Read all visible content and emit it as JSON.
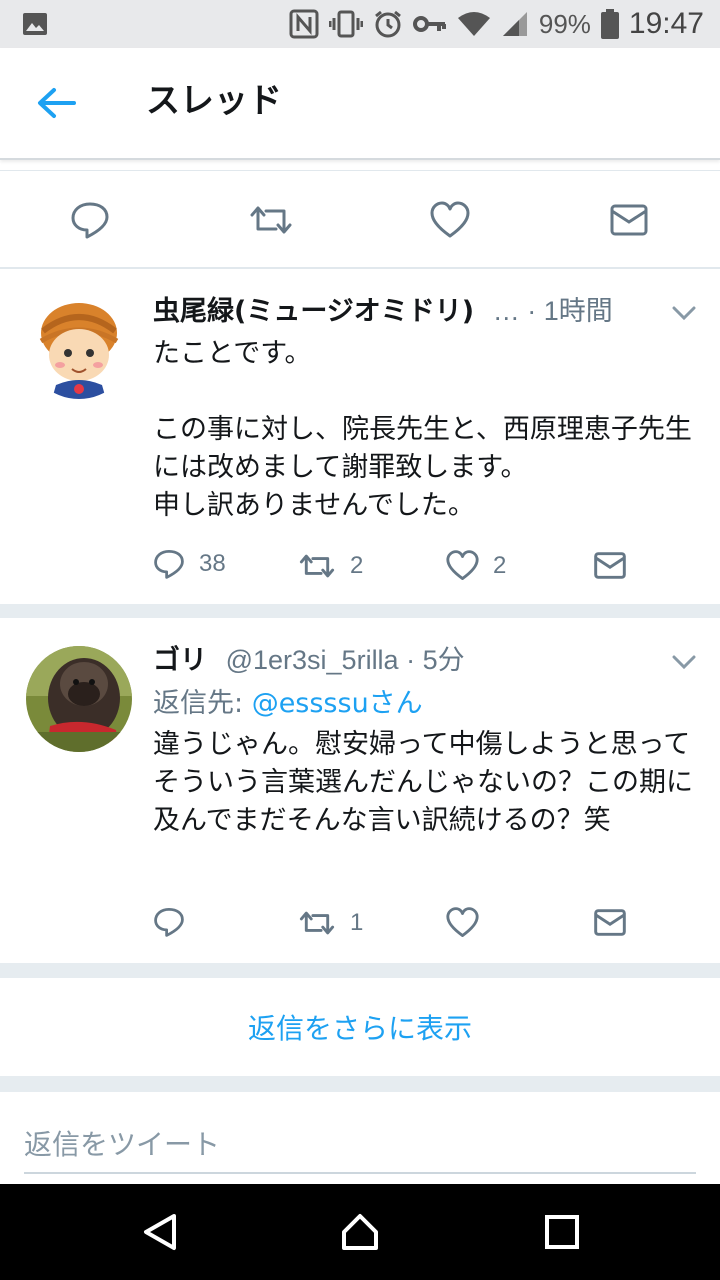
{
  "status_bar": {
    "battery": "99%",
    "time": "19:47",
    "icons": [
      "image-icon",
      "nfc-icon",
      "vibrate-icon",
      "alarm-icon",
      "key-icon",
      "wifi-icon",
      "signal-icon",
      "battery-icon"
    ]
  },
  "app_bar": {
    "title": "スレッド",
    "back_icon": "arrow-left-icon"
  },
  "main_tweet_actions": {
    "icons": [
      "reply-icon",
      "retweet-icon",
      "like-icon",
      "dm-icon"
    ]
  },
  "tweets": [
    {
      "name": "虫尾緑(ミュージオミドリ)",
      "meta": "… · 1時間",
      "body": "たことです。\n\nこの事に対し、院長先生と、西原理恵子先生には改めまして謝罪致します。\n申し訳ありませんでした。",
      "replies": "38",
      "retweets": "2",
      "likes": "2"
    },
    {
      "name": "ゴリ",
      "meta": "@1er3si_5rilla · 5分",
      "reply_prefix": "返信先: ",
      "reply_handle": "@essssuさん",
      "body": "違うじゃん。慰安婦って中傷しようと思ってそういう言葉選んだんじゃないの？この期に及んでまだそんな言い訳続けるの？笑",
      "replies": "",
      "retweets": "1",
      "likes": ""
    }
  ],
  "more_replies_label": "返信をさらに表示",
  "compose": {
    "placeholder": "返信をツイート"
  },
  "colors": {
    "accent": "#1da1f2",
    "secondary_text": "#657786",
    "divider": "#e6ecf0"
  }
}
